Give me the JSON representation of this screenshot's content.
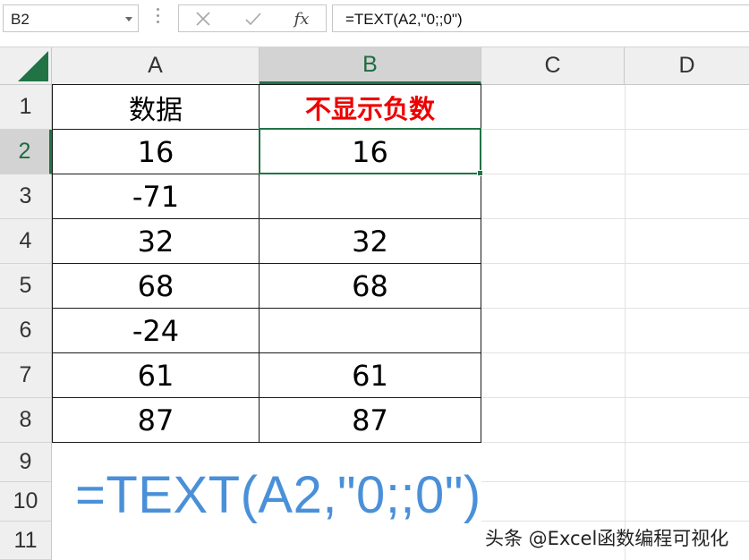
{
  "formula_bar": {
    "name_box": "B2",
    "cancel_icon": "cancel-x-icon",
    "enter_icon": "checkmark-icon",
    "fx_label": "fx",
    "formula": "=TEXT(A2,\"0;;0\")"
  },
  "columns": [
    "A",
    "B",
    "C",
    "D"
  ],
  "rows": [
    "1",
    "2",
    "3",
    "4",
    "5",
    "6",
    "7",
    "8",
    "9",
    "10",
    "11"
  ],
  "selected_cell": "B2",
  "table": {
    "header_a": "数据",
    "header_b": "不显示负数",
    "header_b_color": "#ee0000",
    "data": [
      {
        "a": "16",
        "b": "16"
      },
      {
        "a": "-71",
        "b": ""
      },
      {
        "a": "32",
        "b": "32"
      },
      {
        "a": "68",
        "b": "68"
      },
      {
        "a": "-24",
        "b": ""
      },
      {
        "a": "61",
        "b": "61"
      },
      {
        "a": "87",
        "b": "87"
      }
    ]
  },
  "big_formula": "=TEXT(A2,\"0;;0\")",
  "big_formula_color": "#4a90d9",
  "watermark": "头条 @Excel函数编程可视化",
  "accent_color": "#217346"
}
